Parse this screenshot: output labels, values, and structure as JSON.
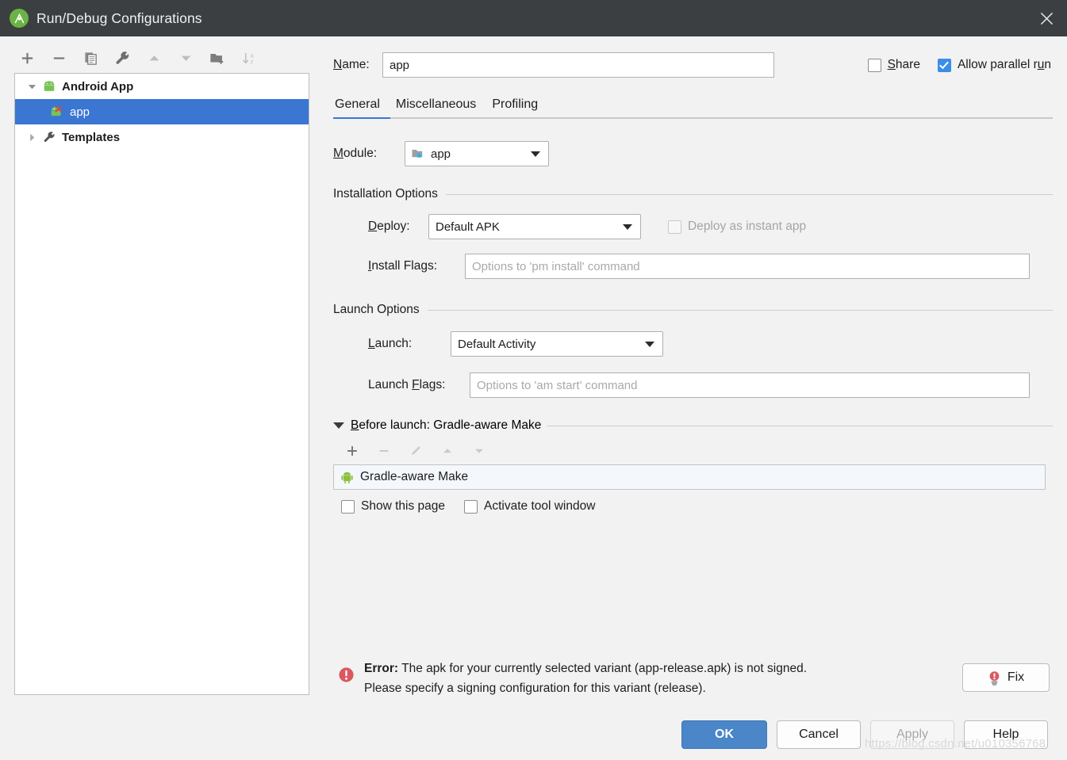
{
  "window": {
    "title": "Run/Debug Configurations",
    "logo_icon": "android-studio-logo-icon",
    "close_icon": "close-icon"
  },
  "sidebar": {
    "toolbar": [
      {
        "name": "add-configuration-button",
        "icon": "plus-icon",
        "enabled": true
      },
      {
        "name": "remove-configuration-button",
        "icon": "minus-icon",
        "enabled": true
      },
      {
        "name": "copy-configuration-button",
        "icon": "copy-icon",
        "enabled": true
      },
      {
        "name": "edit-templates-button",
        "icon": "wrench-icon",
        "enabled": true
      },
      {
        "name": "move-up-button",
        "icon": "arrow-up-icon",
        "enabled": false
      },
      {
        "name": "move-down-button",
        "icon": "arrow-down-icon",
        "enabled": false
      },
      {
        "name": "new-folder-button",
        "icon": "folder-add-icon",
        "enabled": true
      },
      {
        "name": "sort-alphabetically-button",
        "icon": "sort-az-icon",
        "enabled": false
      }
    ],
    "tree": [
      {
        "label": "Android App",
        "icon": "android-icon",
        "expanded": true,
        "level": 0,
        "selected": false
      },
      {
        "label": "app",
        "icon": "android-error-icon",
        "level": 1,
        "selected": true
      },
      {
        "label": "Templates",
        "icon": "wrench-icon",
        "expanded": false,
        "level": 0,
        "selected": false
      }
    ]
  },
  "header": {
    "name_label": "Name:",
    "name_mnemonic": "N",
    "name_value": "app",
    "share_label": "Share",
    "share_checked": false,
    "allow_parallel_label": "Allow parallel run",
    "allow_parallel_checked": true
  },
  "tabs": [
    {
      "label": "General",
      "active": true
    },
    {
      "label": "Miscellaneous",
      "active": false
    },
    {
      "label": "Profiling",
      "active": false
    }
  ],
  "general": {
    "module_label": "Module:",
    "module_value": "app",
    "module_icon": "module-icon",
    "installation_options_title": "Installation Options",
    "deploy_label": "Deploy:",
    "deploy_value": "Default APK",
    "instant_app_label": "Deploy as instant app",
    "instant_app_checked": false,
    "instant_app_enabled": false,
    "install_flags_label": "Install Flags:",
    "install_flags_value": "",
    "install_flags_placeholder": "Options to 'pm install' command",
    "launch_options_title": "Launch Options",
    "launch_label": "Launch:",
    "launch_value": "Default Activity",
    "launch_flags_label": "Launch Flags:",
    "launch_flags_value": "",
    "launch_flags_placeholder": "Options to 'am start' command"
  },
  "before_launch": {
    "header": "Before launch: Gradle-aware Make",
    "expanded": true,
    "toolbar": [
      {
        "name": "before-launch-add-button",
        "icon": "plus-icon",
        "enabled": true
      },
      {
        "name": "before-launch-remove-button",
        "icon": "minus-icon",
        "enabled": false
      },
      {
        "name": "before-launch-edit-button",
        "icon": "pencil-icon",
        "enabled": false
      },
      {
        "name": "before-launch-move-up-button",
        "icon": "arrow-up-icon",
        "enabled": false
      },
      {
        "name": "before-launch-move-down-button",
        "icon": "arrow-down-icon",
        "enabled": false
      }
    ],
    "task": {
      "label": "Gradle-aware Make",
      "icon": "android-icon"
    },
    "show_page_label": "Show this page",
    "show_page_checked": false,
    "activate_tool_window_label": "Activate tool window",
    "activate_tool_window_checked": false
  },
  "error": {
    "prefix": "Error:",
    "line1": " The apk for your currently selected variant (app-release.apk) is not signed.",
    "line2": "Please specify a signing configuration for this variant (release).",
    "icon": "error-circle-icon",
    "fix_label": "Fix",
    "fix_icon": "lightbulb-error-icon"
  },
  "footer": {
    "ok_label": "OK",
    "cancel_label": "Cancel",
    "apply_label": "Apply",
    "apply_enabled": false,
    "help_label": "Help"
  },
  "watermark": "https://blog.csdn.net/u010356768",
  "colors": {
    "titlebar_bg": "#3c3f41",
    "selection_blue": "#3a76d2",
    "accent_blue": "#3a8ee8",
    "primary_button": "#4a86c8",
    "error_red": "#db5860",
    "android_green": "#6ab344",
    "panel_bg": "#f2f2f2"
  }
}
